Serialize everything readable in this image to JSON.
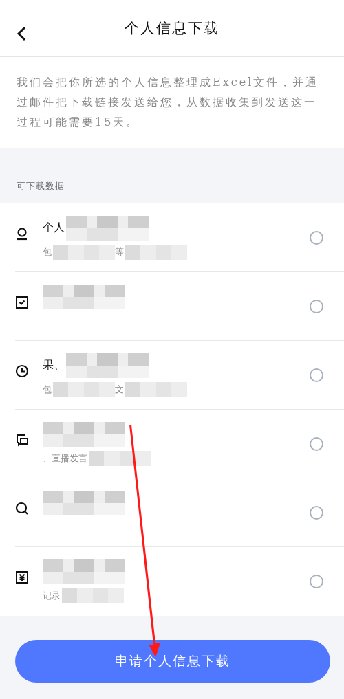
{
  "header": {
    "title": "个人信息下载"
  },
  "intro": "我们会把你所选的个人信息整理成Excel文件，并通过邮件把下载链接发送给您，从数据收集到发送这一过程可能需要15天。",
  "section_label": "可下载数据",
  "items": [
    {
      "kind": "person",
      "title": "个人",
      "details": [
        "包",
        "等"
      ],
      "selected": false
    },
    {
      "kind": "checklist",
      "selected": false
    },
    {
      "kind": "clock",
      "title": "果、",
      "details": [
        "包",
        "文"
      ],
      "selected": false
    },
    {
      "kind": "chat",
      "details": [
        "、直播发言"
      ],
      "selected": false
    },
    {
      "kind": "search",
      "selected": false
    },
    {
      "kind": "yen",
      "details": [
        "记录"
      ],
      "selected": false
    }
  ],
  "submit_button": "申请个人信息下载"
}
